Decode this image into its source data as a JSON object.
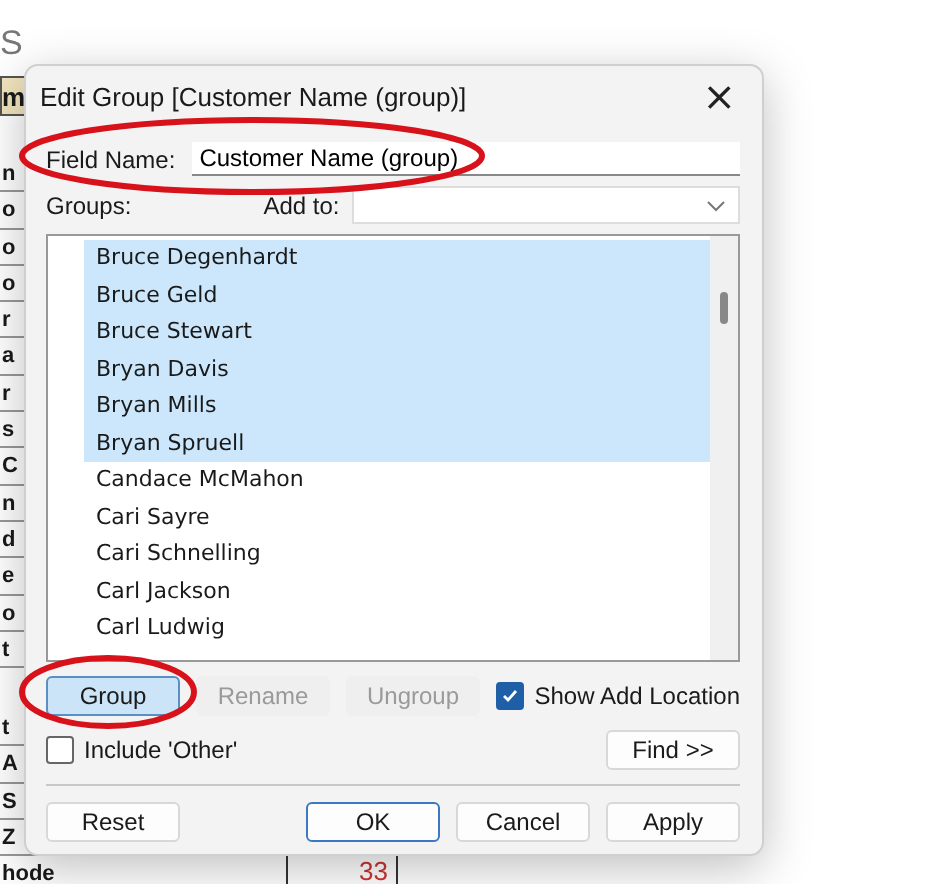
{
  "background_sheet": {
    "title": "S",
    "header": "m",
    "rows_top": [
      "n",
      "o",
      "o",
      "o",
      "r",
      "a",
      "r",
      "s",
      "C",
      "n",
      "d",
      "e",
      "o",
      "t"
    ],
    "rows_bottom": [
      "t",
      "A",
      "S",
      "Z",
      "hode"
    ],
    "value_cell": "33"
  },
  "dialog": {
    "title": "Edit Group [Customer Name (group)]",
    "close": "×",
    "field_name": {
      "label": "Field Name:",
      "value": "Customer Name (group)"
    },
    "groups_label": "Groups:",
    "add_to": {
      "label": "Add to:"
    },
    "members": [
      {
        "name": "Bruce Degenhardt",
        "selected": true
      },
      {
        "name": "Bruce Geld",
        "selected": true
      },
      {
        "name": "Bruce Stewart",
        "selected": true
      },
      {
        "name": "Bryan Davis",
        "selected": true
      },
      {
        "name": "Bryan Mills",
        "selected": true
      },
      {
        "name": "Bryan Spruell",
        "selected": true
      },
      {
        "name": "Candace McMahon",
        "selected": false
      },
      {
        "name": "Cari Sayre",
        "selected": false
      },
      {
        "name": "Cari Schnelling",
        "selected": false
      },
      {
        "name": "Carl Jackson",
        "selected": false
      },
      {
        "name": "Carl Ludwig",
        "selected": false
      }
    ],
    "actions": [
      {
        "label": "Group",
        "disabled": false,
        "focused": true
      },
      {
        "label": "Rename",
        "disabled": true,
        "focused": false
      },
      {
        "label": "Ungroup",
        "disabled": true,
        "focused": false
      }
    ],
    "show_add_location": {
      "label": "Show Add Location",
      "checked": true
    },
    "include_other": {
      "label": "Include 'Other'",
      "checked": false
    },
    "find_button": "Find >>",
    "footer_buttons": [
      {
        "label": "Reset",
        "default": false
      },
      {
        "label": "OK",
        "default": true
      },
      {
        "label": "Cancel",
        "default": false
      },
      {
        "label": "Apply",
        "default": false
      }
    ]
  },
  "annotations": [
    {
      "kind": "ellipse"
    },
    {
      "kind": "ellipse"
    }
  ]
}
